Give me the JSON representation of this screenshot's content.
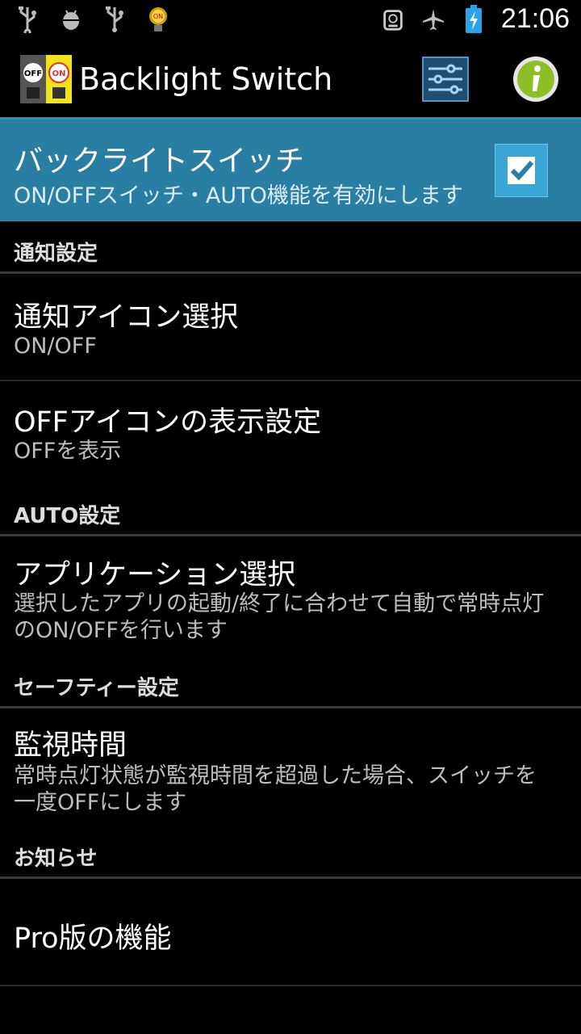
{
  "status_bar": {
    "time": "21:06",
    "left_icons": [
      "usb-icon",
      "android-debug-icon",
      "usb-icon",
      "app-on-icon"
    ],
    "right_icons": [
      "alarm-icon",
      "airplane-icon",
      "battery-charging-icon"
    ]
  },
  "action_bar": {
    "title": "Backlight Switch",
    "icon_off_label": "OFF",
    "icon_on_label": "ON"
  },
  "master": {
    "title": "バックライトスイッチ",
    "subtitle": "ON/OFFスイッチ・AUTO機能を有効にします",
    "checked": true
  },
  "sections": {
    "notify": {
      "header": "通知設定",
      "icon_select_title": "通知アイコン選択",
      "icon_select_sub": "ON/OFF",
      "off_icon_title": "OFFアイコンの表示設定",
      "off_icon_sub": "OFFを表示"
    },
    "auto": {
      "header": "AUTO設定",
      "app_select_title": "アプリケーション選択",
      "app_select_sub": "選択したアプリの起動/終了に合わせて自動で常時点灯のON/OFFを行います"
    },
    "safety": {
      "header": "セーフティー設定",
      "watch_title": "監視時間",
      "watch_sub": "常時点灯状態が監視時間を超過した場合、スイッチを一度OFFにします"
    },
    "news": {
      "header": "お知らせ",
      "pro_title": "Pro版の機能"
    }
  },
  "colors": {
    "accent": "#2b7ea3",
    "divider": "#3a3a3a",
    "background": "#000000"
  }
}
